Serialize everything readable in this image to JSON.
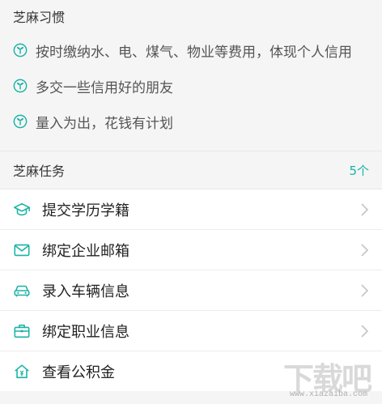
{
  "habits_section": {
    "title": "芝麻习惯",
    "items": [
      {
        "label": "按时缴纳水、电、煤气、物业等费用，体现个人信用",
        "icon": "sprout-icon"
      },
      {
        "label": "多交一些信用好的朋友",
        "icon": "sprout-icon"
      },
      {
        "label": "量入为出，花钱有计划",
        "icon": "sprout-icon"
      }
    ]
  },
  "tasks_section": {
    "title": "芝麻任务",
    "count": "5个",
    "items": [
      {
        "label": "提交学历学籍",
        "icon": "graduation-cap-icon"
      },
      {
        "label": "绑定企业邮箱",
        "icon": "envelope-icon"
      },
      {
        "label": "录入车辆信息",
        "icon": "car-icon"
      },
      {
        "label": "绑定职业信息",
        "icon": "briefcase-icon"
      },
      {
        "label": "查看公积金",
        "icon": "house-icon"
      }
    ]
  },
  "watermark": {
    "text": "下载吧",
    "url": "www.xiazaiba.com"
  },
  "colors": {
    "accent": "#19b3a6",
    "background": "#f5f5f5",
    "list_background": "#ffffff"
  }
}
